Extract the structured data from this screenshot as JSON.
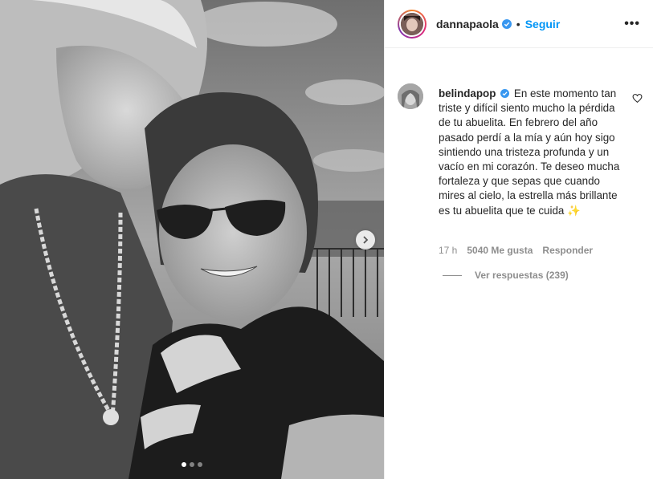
{
  "post": {
    "photo_alt": "",
    "carousel": {
      "total": 3,
      "active": 0
    }
  },
  "header": {
    "username": "dannapaola",
    "verified": true,
    "bullet": "•",
    "follow_label": "Seguir",
    "more_label": "•••"
  },
  "comment": {
    "username": "belindapop",
    "verified": true,
    "text": "En este momento tan triste y difícil siento mucho la pérdida de tu abuelita. En febrero del año pasado perdí a la mía y aún hoy sigo sintiendo una tristeza profunda y un vacío en mi corazón. Te deseo mucha fortaleza y que sepas que cuando mires al cielo, la estrella más brillante es tu abuelita que te cuida",
    "emoji": "✨",
    "time": "17 h",
    "likes": "5040 Me gusta",
    "reply_label": "Responder",
    "view_replies": "Ver respuestas (239)"
  },
  "colors": {
    "link": "#0095f6",
    "muted": "#8e8e8e",
    "text": "#262626",
    "verified": "#3897f0"
  },
  "icons": [
    "verified-badge-icon",
    "heart-icon",
    "chevron-right-icon",
    "more-icon"
  ]
}
